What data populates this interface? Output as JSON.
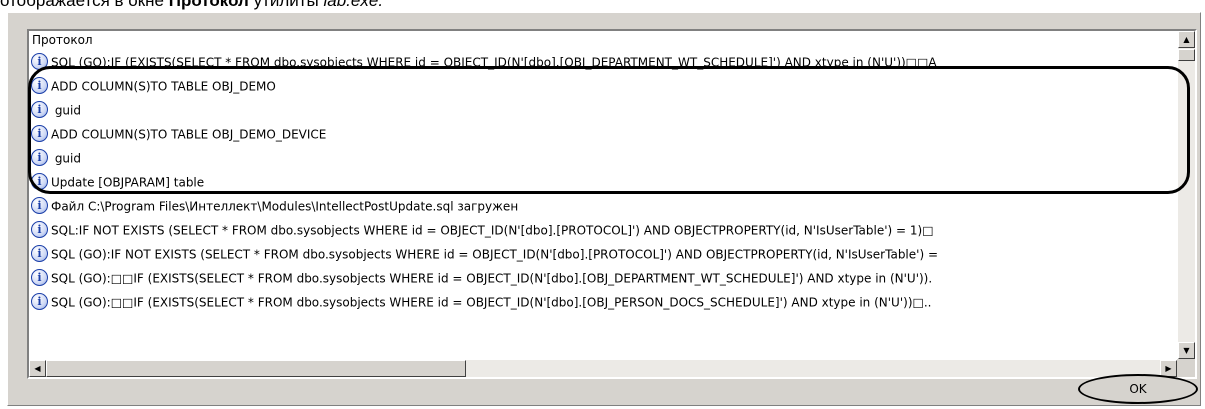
{
  "caption": {
    "prefix": "отображается в окне ",
    "bold": "Протокол",
    "mid": " утилиты ",
    "italic": "lab.exe."
  },
  "protocol": {
    "header": "Протокол",
    "rows": [
      "SQL (GO):IF (EXISTS(SELECT * FROM dbo.sysobjects WHERE id = OBJECT_ID(N'[dbo].[OBJ_DEPARTMENT_WT_SCHEDULE]') AND xtype in (N'U'))□□A",
      "ADD COLUMN(S)TO TABLE OBJ_DEMO",
      "  guid",
      "ADD COLUMN(S)TO TABLE OBJ_DEMO_DEVICE",
      "  guid",
      "Update [OBJPARAM] table",
      "Файл C:\\Program Files\\Интеллект\\Modules\\IntellectPostUpdate.sql загружен",
      "SQL:IF NOT EXISTS (SELECT * FROM dbo.sysobjects WHERE id = OBJECT_ID(N'[dbo].[PROTOCOL]') AND OBJECTPROPERTY(id, N'IsUserTable') = 1)□",
      "SQL (GO):IF NOT EXISTS (SELECT * FROM dbo.sysobjects WHERE id = OBJECT_ID(N'[dbo].[PROTOCOL]') AND OBJECTPROPERTY(id, N'IsUserTable') =",
      "SQL (GO):□□IF (EXISTS(SELECT * FROM dbo.sysobjects WHERE id = OBJECT_ID(N'[dbo].[OBJ_DEPARTMENT_WT_SCHEDULE]') AND xtype in (N'U')).",
      "SQL (GO):□□IF (EXISTS(SELECT * FROM dbo.sysobjects WHERE id = OBJECT_ID(N'[dbo].[OBJ_PERSON_DOCS_SCHEDULE]') AND xtype in (N'U'))□.."
    ]
  },
  "ok_label": "OK",
  "icons": {
    "row": "info-icon",
    "scroll_up": "arrow-up-icon",
    "scroll_down": "arrow-down-icon",
    "scroll_left": "arrow-left-icon",
    "scroll_right": "arrow-right-icon"
  }
}
